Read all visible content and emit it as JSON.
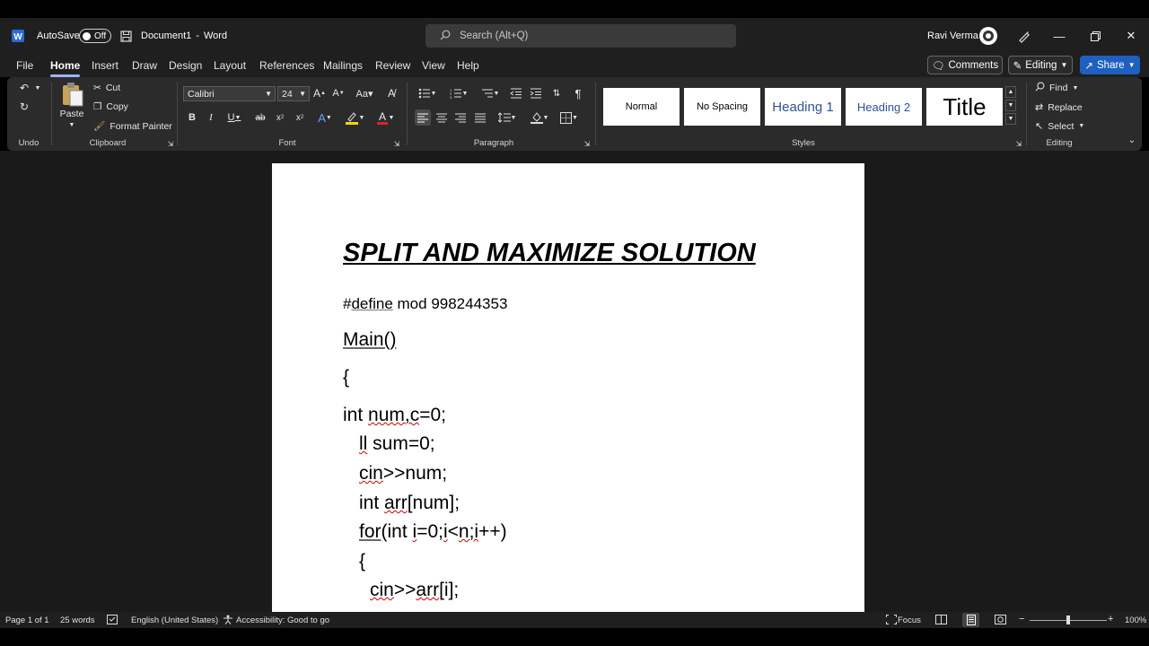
{
  "titlebar": {
    "autosave_label": "AutoSave",
    "autosave_state": "Off",
    "doc_name": "Document1",
    "separator": "-",
    "app_name": "Word",
    "search_placeholder": "Search (Alt+Q)",
    "user_name": "Ravi Verma"
  },
  "menu": {
    "tabs": [
      "File",
      "Home",
      "Insert",
      "Draw",
      "Design",
      "Layout",
      "References",
      "Mailings",
      "Review",
      "View",
      "Help"
    ],
    "active_tab": "Home",
    "comments_label": "Comments",
    "editing_label": "Editing",
    "share_label": "Share"
  },
  "ribbon": {
    "groups": {
      "undo": "Undo",
      "clipboard": "Clipboard",
      "font": "Font",
      "paragraph": "Paragraph",
      "styles": "Styles",
      "editing": "Editing"
    },
    "clipboard": {
      "paste": "Paste",
      "cut": "Cut",
      "copy": "Copy",
      "format_painter": "Format Painter"
    },
    "font": {
      "family": "Calibri",
      "size": "24"
    },
    "styles": [
      "Normal",
      "No Spacing",
      "Heading 1",
      "Heading 2",
      "Title"
    ],
    "editing": {
      "find": "Find",
      "replace": "Replace",
      "select": "Select"
    }
  },
  "document": {
    "title": "SPLIT AND MAXIMIZE SOLUTION",
    "lines": [
      {
        "indent": 0,
        "size": 17,
        "text": "#define mod 998244353"
      },
      {
        "indent": 0,
        "size": 21,
        "text": "Main()"
      },
      {
        "indent": 0,
        "size": 21,
        "text": "{"
      },
      {
        "indent": 0,
        "size": 21,
        "text": "int num,c=0;"
      },
      {
        "indent": 1,
        "size": 21,
        "text": "ll sum=0;"
      },
      {
        "indent": 1,
        "size": 21,
        "text": "cin>>num;"
      },
      {
        "indent": 1,
        "size": 21,
        "text": "int arr[num];"
      },
      {
        "indent": 1,
        "size": 21,
        "text": "for(int i=0;i<n;i++)"
      },
      {
        "indent": 1,
        "size": 21,
        "text": "{"
      },
      {
        "indent": 2,
        "size": 21,
        "text": "cin>>arr[i];"
      }
    ]
  },
  "status": {
    "page": "Page 1 of 1",
    "words": "25 words",
    "language": "English (United States)",
    "accessibility": "Accessibility: Good to go",
    "focus": "Focus",
    "zoom": "100%",
    "zoom_fraction": 0.5
  },
  "colors": {
    "share_blue": "#1f5fbf",
    "ribbon_bg": "#2b2b2b",
    "titlebar_bg": "#1f1f1f"
  }
}
